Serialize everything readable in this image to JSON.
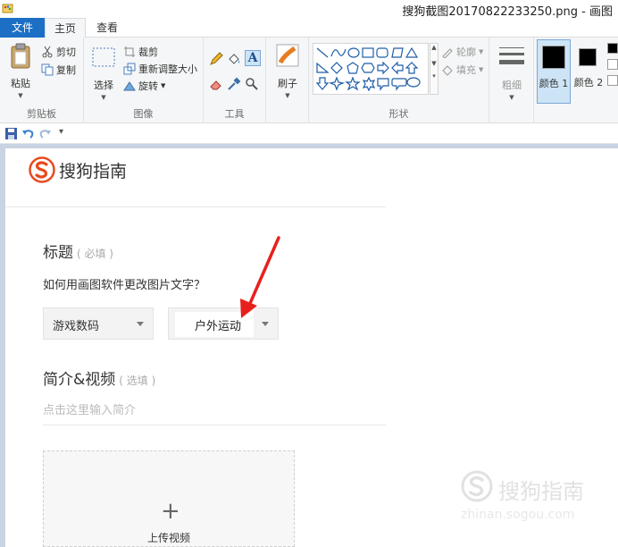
{
  "window": {
    "title": "搜狗截图20170822233250.png - 画图"
  },
  "tabs": {
    "file": "文件",
    "home": "主页",
    "view": "查看"
  },
  "ribbon": {
    "clipboard": {
      "paste": "粘贴",
      "cut": "剪切",
      "copy": "复制",
      "label": "剪贴板"
    },
    "image": {
      "select": "选择",
      "crop": "裁剪",
      "resize": "重新调整大小",
      "rotate": "旋转",
      "label": "图像"
    },
    "tools": {
      "label": "工具",
      "text_tool": "A"
    },
    "brushes": {
      "label": "刷子"
    },
    "shapes": {
      "outline": "轮廓",
      "fill": "填充",
      "label": "形状"
    },
    "size": {
      "label": "粗细"
    },
    "colors": {
      "color1": "颜色 1",
      "color2": "颜色 2"
    }
  },
  "page": {
    "logo_text": "搜狗指南",
    "title_label": "标题",
    "title_hint": "( 必填 )",
    "title_value": "如何用画图软件更改图片文字？",
    "category1": "游戏数码",
    "category2": "户外运动",
    "intro_label": "简介&视频",
    "intro_hint": "( 选填 )",
    "intro_placeholder": "点击这里输入简介",
    "upload_plus": "+",
    "upload_label": "上传视频"
  },
  "watermark": {
    "text": "搜狗指南",
    "url": "zhinan.sogou.com"
  },
  "colors": {
    "accent": "#1c6fc5",
    "arrow": "#e8201c",
    "logo": "#e8491d",
    "selected_color_bg": "#cde4f7"
  }
}
